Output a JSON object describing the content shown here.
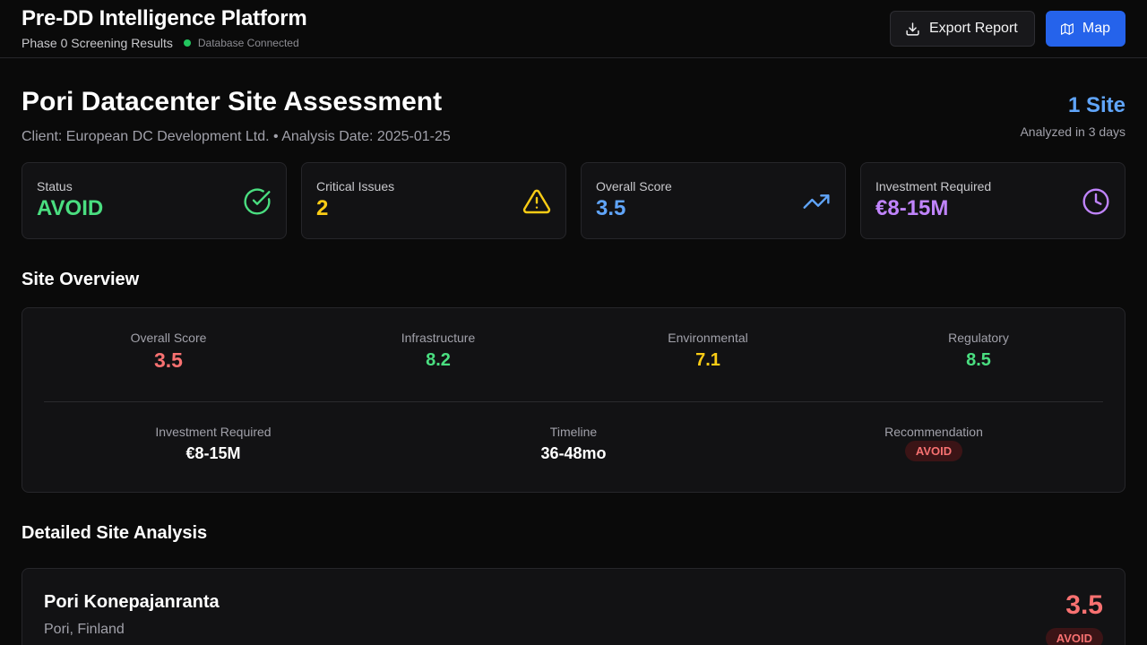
{
  "header": {
    "title": "Pre-DD Intelligence Platform",
    "subtitle": "Phase 0 Screening Results",
    "db_status": "Database Connected",
    "export_label": "Export Report",
    "map_label": "Map"
  },
  "page": {
    "title": "Pori Datacenter Site Assessment",
    "meta": "Client: European DC Development Ltd. • Analysis Date: 2025-01-25",
    "site_count": "1 Site",
    "site_count_sub": "Analyzed in 3 days"
  },
  "stats": [
    {
      "label": "Status",
      "value": "AVOID",
      "color": "#4ade80",
      "icon": "check-circle-icon"
    },
    {
      "label": "Critical Issues",
      "value": "2",
      "color": "#facc15",
      "icon": "warning-triangle-icon"
    },
    {
      "label": "Overall Score",
      "value": "3.5",
      "color": "#60a5fa",
      "icon": "trending-up-icon"
    },
    {
      "label": "Investment Required",
      "value": "€8-15M",
      "color": "#c084fc",
      "icon": "clock-icon"
    }
  ],
  "overview": {
    "title": "Site Overview",
    "row1": [
      {
        "label": "Overall Score",
        "value": "3.5",
        "color": "#f87171"
      },
      {
        "label": "Infrastructure",
        "value": "8.2",
        "color": "#4ade80"
      },
      {
        "label": "Environmental",
        "value": "7.1",
        "color": "#facc15"
      },
      {
        "label": "Regulatory",
        "value": "8.5",
        "color": "#4ade80"
      }
    ],
    "row2": [
      {
        "label": "Investment Required",
        "value": "€8-15M"
      },
      {
        "label": "Timeline",
        "value": "36-48mo"
      },
      {
        "label": "Recommendation",
        "value": "AVOID"
      }
    ]
  },
  "detail": {
    "title": "Detailed Site Analysis",
    "site_name": "Pori Konepajanranta",
    "location": "Pori, Finland",
    "score": "3.5",
    "recommendation": "AVOID"
  }
}
